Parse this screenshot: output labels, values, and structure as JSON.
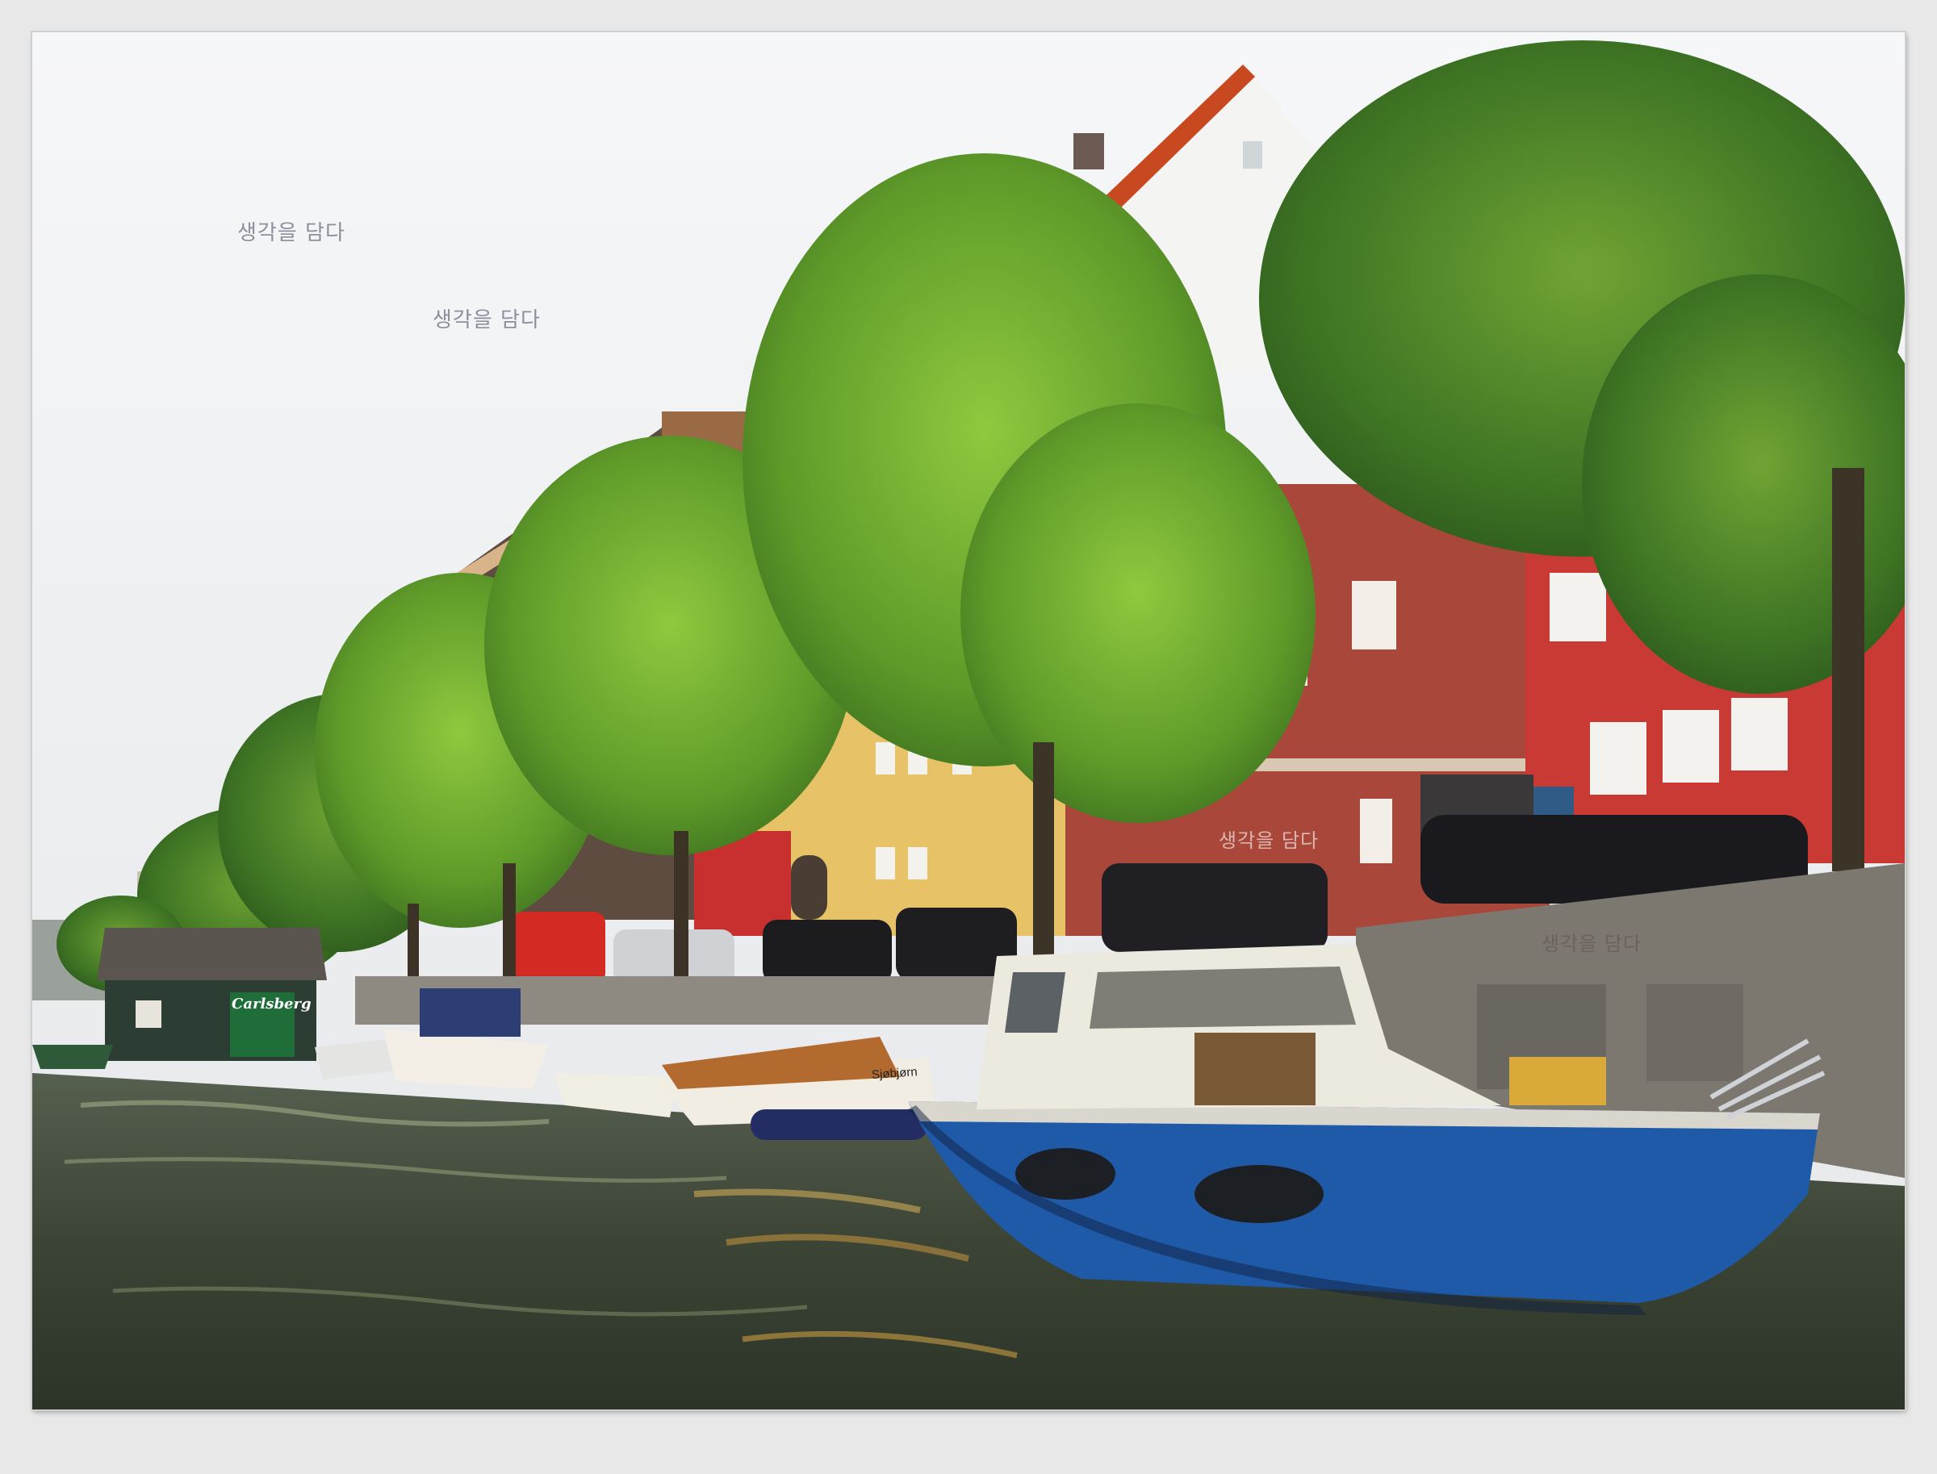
{
  "scene": {
    "subject": "Christianshavn canal with moored boats and colourful houses",
    "watermark_text": "생각을 담다",
    "sign_text": "Carlsberg",
    "boat_name": "Sjøbjørn"
  },
  "colors": {
    "frame": "#e8e8e8",
    "sky": "#eef0f2",
    "water": "#3d4536",
    "tree_green": "#6aa52c",
    "red_house": "#c93a35",
    "brown_house": "#a9473a",
    "yellow_house": "#e8c267",
    "blue_boat": "#1f5aa8"
  }
}
